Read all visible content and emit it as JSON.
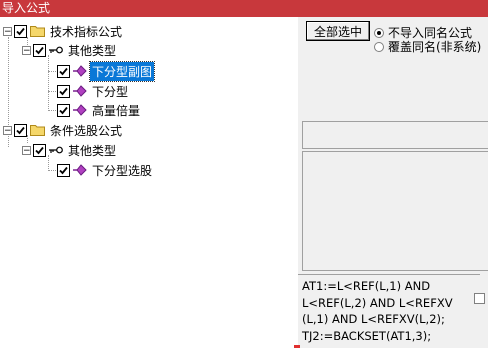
{
  "window": {
    "title": "导入公式"
  },
  "tree": {
    "root1": {
      "label": "技术指标公式"
    },
    "group1": {
      "label": "其他类型"
    },
    "item1": {
      "label": "下分型副图"
    },
    "item2": {
      "label": "下分型"
    },
    "item3": {
      "label": "高量倍量"
    },
    "root2": {
      "label": "条件选股公式"
    },
    "group2": {
      "label": "其他类型"
    },
    "item4": {
      "label": "下分型选股"
    },
    "expander_symbol": "−"
  },
  "options": {
    "select_all_label": "全部选中",
    "radio_no_import": "不导入同名公式",
    "radio_overwrite": "覆盖同名(非系统)"
  },
  "code": {
    "lines": [
      "AT1:=L<REF(L,1) AND",
      "L<REF(L,2) AND L<REFXV",
      "(L,1) AND L<REFXV(L,2);",
      "TJ2:=BACKSET(AT1,3);"
    ]
  },
  "colors": {
    "titlebar": "#c8383c",
    "selection": "#0a78d7",
    "folder": "#e8c84a",
    "formula_icon": "#b040c0"
  }
}
